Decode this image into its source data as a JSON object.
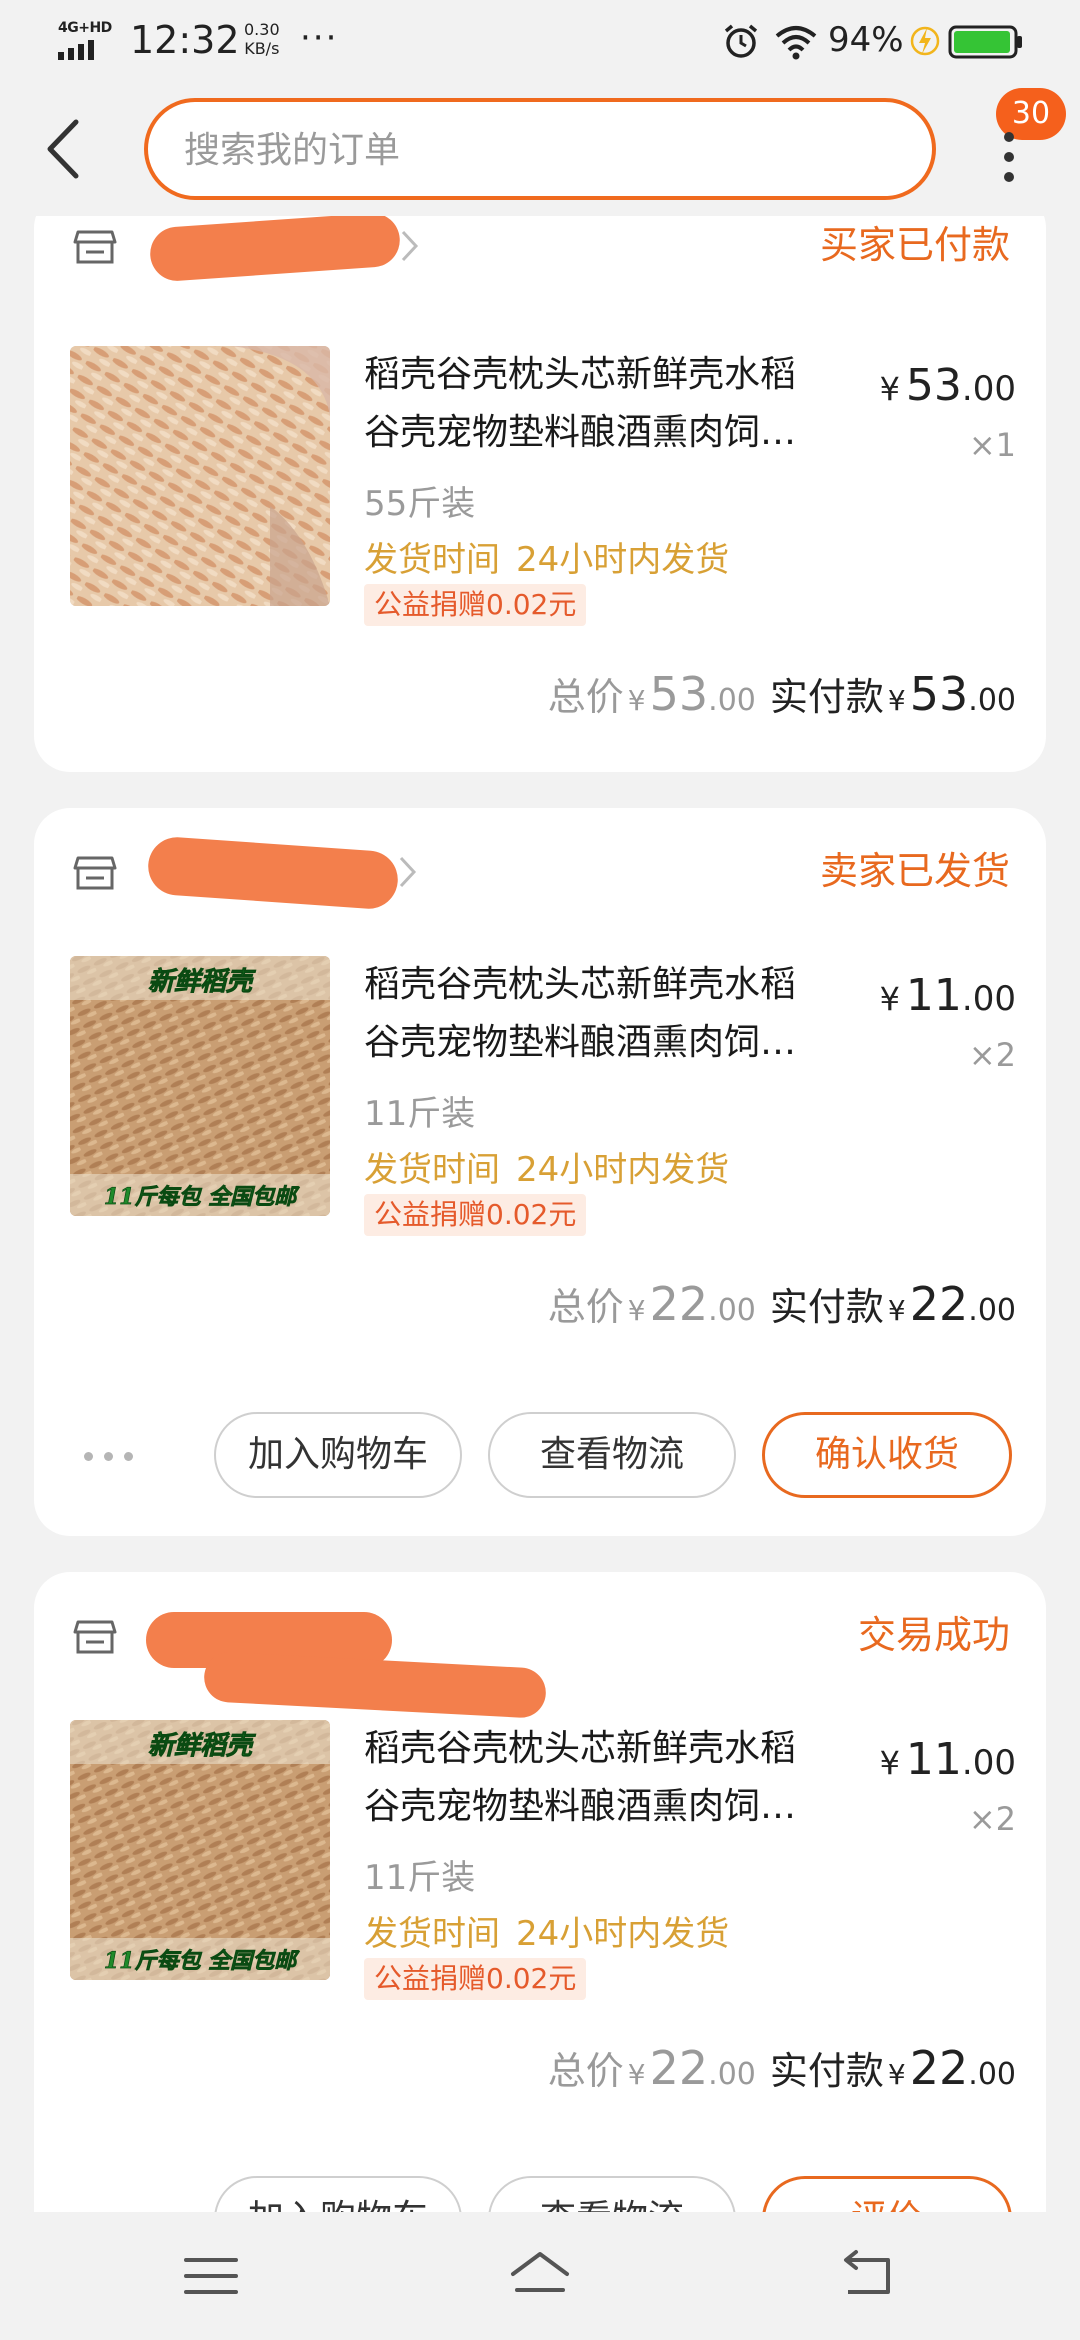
{
  "status_bar": {
    "network": "4G+HD",
    "time": "12:32",
    "speed_value": "0.30",
    "speed_unit": "KB/s",
    "more": "···",
    "battery_pct": "94%"
  },
  "header": {
    "search_placeholder": "搜索我的订单",
    "badge_count": "30"
  },
  "orders": [
    {
      "shop_name": "",
      "status": "买家已付款",
      "product": {
        "title": "稻壳谷壳枕头芯新鲜壳水稻谷壳宠物垫料酿酒熏肉饲料",
        "title_line1": "稻壳谷壳枕头芯新鲜壳水稻",
        "title_line2": "谷壳宠物垫料酿酒熏肉饲…",
        "spec": "55斤装",
        "ship_label": "发货时间",
        "ship_value": "24小时内发货",
        "donation": "公益捐赠0.02元",
        "price_int": "53",
        "price_dec": ".00",
        "qty": "×1"
      },
      "total_label": "总价",
      "total_int": "53",
      "total_dec": ".00",
      "paid_label": "实付款",
      "paid_int": "53",
      "paid_dec": ".00"
    },
    {
      "shop_name": "",
      "status": "卖家已发货",
      "product": {
        "title": "稻壳谷壳枕头芯新鲜壳水稻谷壳宠物垫料酿酒熏肉饲料",
        "title_line1": "稻壳谷壳枕头芯新鲜壳水稻",
        "title_line2": "谷壳宠物垫料酿酒熏肉饲…",
        "spec": "11斤装",
        "ship_label": "发货时间",
        "ship_value": "24小时内发货",
        "donation": "公益捐赠0.02元",
        "price_int": "11",
        "price_dec": ".00",
        "qty": "×2",
        "image_top_text": "新鲜稻壳",
        "image_bottom_text": "11斤每包 全国包邮"
      },
      "total_label": "总价",
      "total_int": "22",
      "total_dec": ".00",
      "paid_label": "实付款",
      "paid_int": "22",
      "paid_dec": ".00",
      "buttons": [
        "加入购物车",
        "查看物流",
        "确认收货"
      ]
    },
    {
      "shop_name": "",
      "status": "交易成功",
      "product": {
        "title": "稻壳谷壳枕头芯新鲜壳水稻谷壳宠物垫料酿酒熏肉饲料",
        "title_line1": "稻壳谷壳枕头芯新鲜壳水稻",
        "title_line2": "谷壳宠物垫料酿酒熏肉饲…",
        "spec": "11斤装",
        "ship_label": "发货时间",
        "ship_value": "24小时内发货",
        "donation": "公益捐赠0.02元",
        "price_int": "11",
        "price_dec": ".00",
        "qty": "×2",
        "image_top_text": "新鲜稻壳",
        "image_bottom_text": "11斤每包 全国包邮"
      },
      "total_label": "总价",
      "total_int": "22",
      "total_dec": ".00",
      "paid_label": "实付款",
      "paid_int": "22",
      "paid_dec": ".00",
      "buttons": [
        "加入购物车",
        "查看物流",
        "评价"
      ]
    }
  ],
  "currency": "¥",
  "colors": {
    "accent": "#e8691f",
    "ship_text": "#d8a035",
    "donation_text": "#e55a2b",
    "donation_bg": "#fdece3",
    "badge": "#f5601c",
    "redaction": "#f37f4c"
  },
  "icons": {
    "back": "chevron-left-icon",
    "more": "more-vertical-icon",
    "store": "store-icon",
    "menu": "menu-icon",
    "home": "home-icon",
    "return": "return-icon"
  }
}
